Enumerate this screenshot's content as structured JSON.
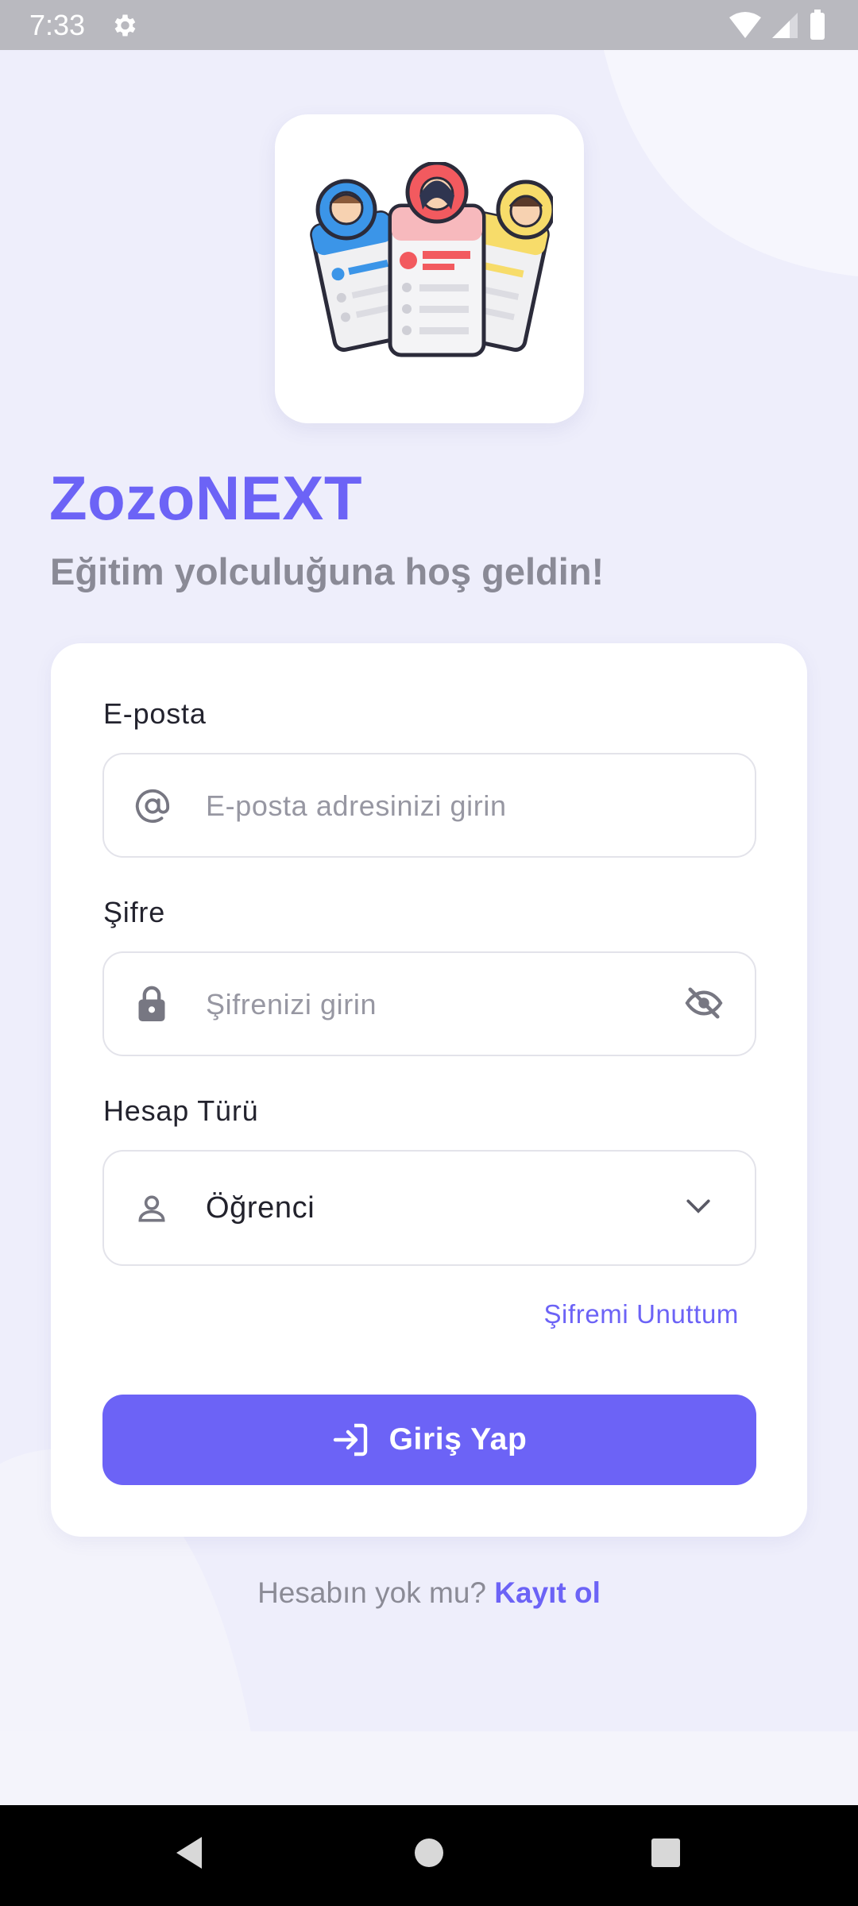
{
  "status_bar": {
    "time": "7:33",
    "icons": [
      "gear-icon",
      "wifi-icon",
      "cell-signal-icon",
      "battery-icon"
    ]
  },
  "app": {
    "title": "ZozoNEXT",
    "subtitle": "Eğitim yolculuğuna hoş geldin!",
    "logo": "student-cards-illustration"
  },
  "form": {
    "email": {
      "label": "E-posta",
      "placeholder": "E-posta adresinizi girin",
      "icon": "at-sign-icon"
    },
    "password": {
      "label": "Şifre",
      "placeholder": "Şifrenizi girin",
      "icon": "lock-icon",
      "toggle_icon": "eye-off-icon"
    },
    "account_type": {
      "label": "Hesap Türü",
      "value": "Öğrenci",
      "icon": "person-icon"
    },
    "forgot_password": "Şifremi Unuttum",
    "login_button": "Giriş Yap"
  },
  "signup": {
    "prompt": "Hesabın yok mu?",
    "link": "Kayıt ol"
  },
  "colors": {
    "accent": "#6c63f6",
    "background": "#eeeefb",
    "card": "#ffffff"
  },
  "nav_bar": [
    "back-icon",
    "home-icon",
    "recents-icon"
  ]
}
